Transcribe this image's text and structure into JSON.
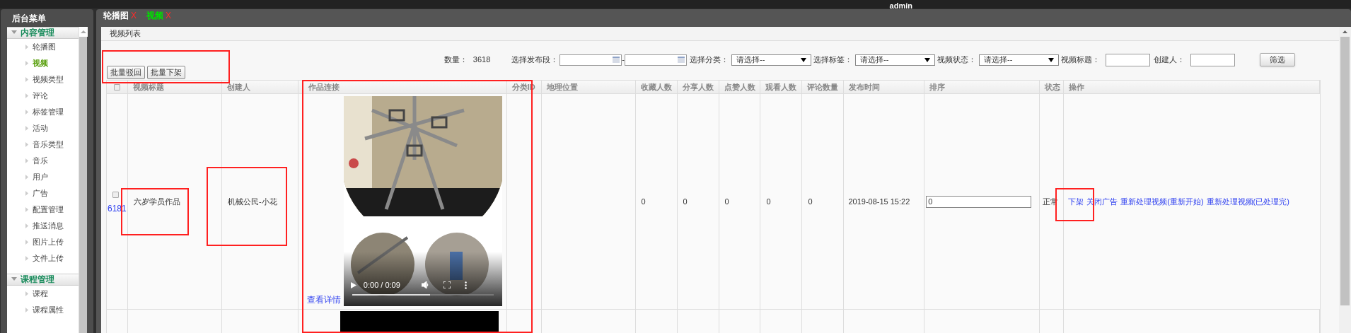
{
  "header": {
    "user": "admin"
  },
  "sidebar": {
    "title": "后台菜单",
    "sections": [
      {
        "label": "内容管理",
        "expanded": true,
        "items": [
          {
            "label": "轮播图",
            "selected": false
          },
          {
            "label": "视频",
            "selected": true
          },
          {
            "label": "视频类型",
            "selected": false
          },
          {
            "label": "评论",
            "selected": false
          },
          {
            "label": "标签管理",
            "selected": false
          },
          {
            "label": "活动",
            "selected": false
          },
          {
            "label": "音乐类型",
            "selected": false
          },
          {
            "label": "音乐",
            "selected": false
          },
          {
            "label": "用户",
            "selected": false
          },
          {
            "label": "广告",
            "selected": false
          },
          {
            "label": "配置管理",
            "selected": false
          },
          {
            "label": "推送消息",
            "selected": false
          },
          {
            "label": "图片上传",
            "selected": false
          },
          {
            "label": "文件上传",
            "selected": false
          }
        ]
      },
      {
        "label": "课程管理",
        "expanded": true,
        "items": [
          {
            "label": "课程",
            "selected": false
          },
          {
            "label": "课程属性",
            "selected": false
          }
        ]
      }
    ]
  },
  "tabs": [
    {
      "label": "轮播图",
      "selected": false,
      "close": "X"
    },
    {
      "label": "视频",
      "selected": true,
      "close": "X"
    }
  ],
  "panel_title": "视频列表",
  "filters": {
    "count_label": "数量：",
    "count": "3618",
    "date_label": "选择发布段：",
    "date_separator": "-",
    "selects": [
      {
        "label": "选择分类：",
        "value": "请选择--"
      },
      {
        "label": "选择标签：",
        "value": "请选择--"
      },
      {
        "label": "视频状态：",
        "value": "请选择--"
      }
    ],
    "inputs": [
      {
        "label": "视频标题："
      },
      {
        "label": "创建人："
      }
    ],
    "button": "筛选"
  },
  "batch_buttons": [
    "批量驳回",
    "批量下架"
  ],
  "table": {
    "select_all": false,
    "columns": [
      "视频标题",
      "创建人",
      "作品连接",
      "分类ID",
      "地理位置",
      "收藏人数",
      "分享人数",
      "点赞人数",
      "观看人数",
      "评论数量",
      "发布时间",
      "排序",
      "状态",
      "操作"
    ],
    "rows": [
      {
        "selected": false,
        "id": "6181",
        "title": "六岁学员作品",
        "creator": "机械公民-小花",
        "link": "查看详情",
        "video": {
          "time": "0:00 / 0:09",
          "level": 0.55
        },
        "counts": [
          "0",
          "0",
          "0",
          "0",
          "0"
        ],
        "published": "2019-08-15 15:22",
        "sort": "0",
        "status": "正常",
        "actions": [
          "下架",
          "关闭广告",
          "重新处理视频(重新开始)",
          "重新处理视频(已处理完)"
        ]
      }
    ]
  }
}
